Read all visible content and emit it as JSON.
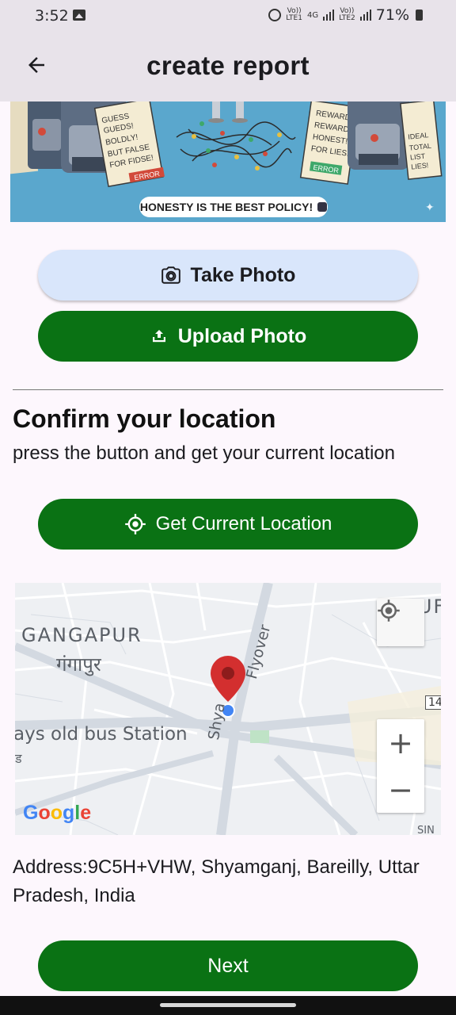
{
  "status_bar": {
    "time": "3:52",
    "net1_top": "Vo))",
    "net1_bottom": "LTE1",
    "net_type": "4G",
    "net2_top": "Vo))",
    "net2_bottom": "LTE2",
    "battery": "71%"
  },
  "app_bar": {
    "title": "create report",
    "back_icon": "arrow-left-icon"
  },
  "banner": {
    "left_sign": [
      "GUESS",
      "GUEDS!",
      "BOLDLY!",
      "BUT FALSE",
      "FOR FIDSE!"
    ],
    "left_tag": "ERROR",
    "right_sign": [
      "REWARD",
      "REWARD",
      "HONEST!",
      "FOR LIES!"
    ],
    "right_tag": "ERROR",
    "far_right_sign": [
      "IDEAL",
      "TOTAL",
      "LIST",
      "LIES!"
    ],
    "pill_text": "HONESTY IS THE BEST POLICY!"
  },
  "photo": {
    "take_label": "Take Photo",
    "upload_label": "Upload Photo"
  },
  "location": {
    "title": "Confirm your location",
    "subtitle": "press the button and get your current location",
    "button_label": "Get Current Location"
  },
  "map": {
    "area_label_en": "GANGAPUR",
    "area_label_hi": "गंगापुर",
    "bus_station": "ays old bus Station",
    "bus_station_hi": "ड",
    "road_label": "Shyam... Flyover",
    "road_left": "Shya",
    "road_right": "Flyover",
    "corner_label": "OUF",
    "route_badge": "14",
    "bottom_right": "SIN",
    "zoom_in": "+",
    "zoom_out": "−",
    "google": [
      "G",
      "o",
      "o",
      "g",
      "l",
      "e"
    ]
  },
  "address": "Address:9C5H+VHW, Shyamganj, Bareilly, Uttar Pradesh, India",
  "next_label": "Next",
  "colors": {
    "primary_green": "#0a7214",
    "take_photo_bg": "#d9e6fb",
    "app_bar_bg": "#e8e3ea",
    "page_bg": "#fdf7fd",
    "map_pin": "#d32f2f",
    "location_dot": "#4285f4"
  }
}
